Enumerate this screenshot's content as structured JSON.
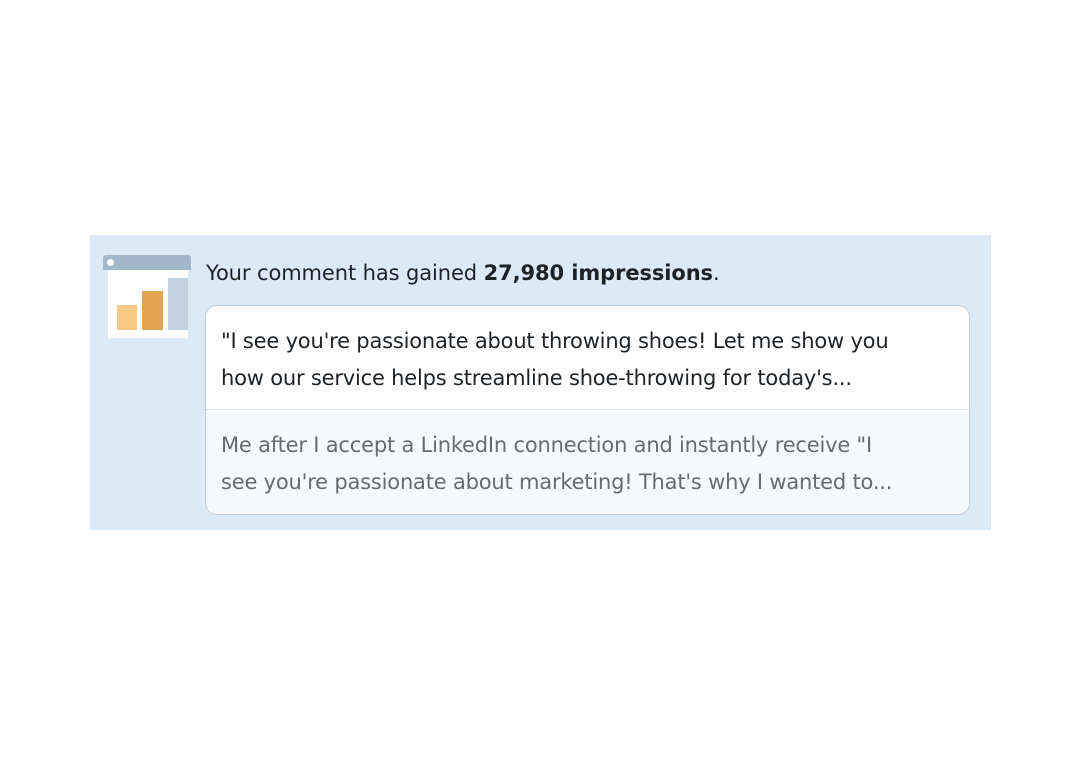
{
  "notification": {
    "headline_prefix": "Your comment has gained",
    "impressions": "27,980 impressions",
    "headline_suffix": ".",
    "thumbnail_icon": "analytics-chart-icon",
    "comment_lines": [
      "\"I see you're passionate about throwing shoes! Let me show you",
      "how our service helps streamline shoe-throwing for today's..."
    ],
    "post_lines": [
      "Me after I accept a LinkedIn connection and instantly receive \"I",
      "see you're passionate about marketing! That's why I wanted to..."
    ]
  },
  "colors": {
    "notification_bg": "#dce9f7",
    "card_border": "#c4ccd6",
    "bar_light_orange": "#f6c987",
    "bar_orange": "#e6a450",
    "bar_blue": "#c0d1e1"
  }
}
